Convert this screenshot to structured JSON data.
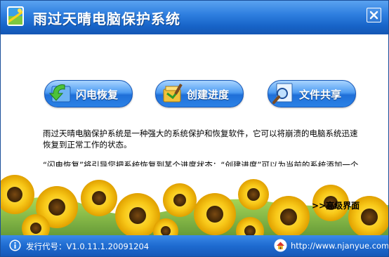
{
  "window": {
    "title": "雨过天晴电脑保护系统"
  },
  "buttons": [
    {
      "label": "闪电恢复",
      "icon": "undo-arrow-icon"
    },
    {
      "label": "创建进度",
      "icon": "create-progress-icon"
    },
    {
      "label": "文件共享",
      "icon": "file-share-magnifier-icon"
    }
  ],
  "description": {
    "paragraph1": "雨过天晴电脑保护系统是一种强大的系统保护和恢复软件，它可以将崩溃的电脑系统迅速恢复到正常工作的状态。",
    "paragraph2": "“闪电恢复”将引导您把系统恢复到某个进度状态；“创建进度”可以为当前的系统添加一个进度；“文件共享”提供在线共享文件服务；更详细的功能请使用“高级设置”。"
  },
  "advanced_link": ">>高级界面",
  "footer": {
    "version_text": "发行代号：V1.0.11.1.20091204",
    "url": "http://www.njanyue.com/"
  },
  "colors": {
    "titlebar": "#1d6ad0",
    "button": "#3a8ae6",
    "footer": "#1e6bd0"
  }
}
